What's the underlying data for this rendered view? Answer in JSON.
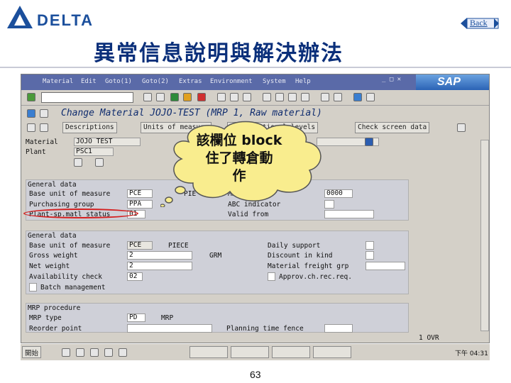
{
  "header": {
    "logo_text": "DELTA",
    "back_label": "Back",
    "title": "異常信息說明與解決辦法"
  },
  "colors": {
    "brand_blue": "#1b4f9c",
    "sap_menu": "#5a6aa8",
    "callout_fill": "#f9ed8e",
    "annotation_red": "#d42020"
  },
  "sap": {
    "menu": [
      "Material",
      "Edit",
      "Goto(1)",
      "Goto(2)",
      "Extras",
      "Environment",
      "System",
      "Help"
    ],
    "brand": "SAP",
    "transaction_title": "Change Material JOJO-TEST (MRP 1, Raw material)",
    "buttons": [
      "Descriptions",
      "Units of measure",
      "Organizational levels",
      "Check screen data"
    ],
    "header_fields": {
      "material_label": "Material",
      "material_value": "JOJO TEST",
      "plant_label": "Plant",
      "plant_value": "PSC1"
    },
    "general_data_1": {
      "title": "General data",
      "rows": [
        {
          "label": "Base unit of measure",
          "value": "PCE",
          "extra": "PIE"
        },
        {
          "label": "Purchasing group",
          "value": "PPA"
        },
        {
          "label": "Plant-sp.matl status",
          "value": "01"
        }
      ],
      "right": [
        {
          "label": "MRP group",
          "value": "0000"
        },
        {
          "label": "ABC indicator",
          "value": ""
        },
        {
          "label": "Valid from",
          "value": ""
        }
      ]
    },
    "general_data_2": {
      "title": "General data",
      "rows": [
        {
          "label": "Base unit of measure",
          "value": "PCE",
          "extra": "PIECE"
        },
        {
          "label": "Gross weight",
          "value": "2",
          "extra": "GRM"
        },
        {
          "label": "Net weight",
          "value": "2"
        },
        {
          "label": "Availability check",
          "value": "02"
        }
      ],
      "right": [
        {
          "label": "Daily support"
        },
        {
          "label": "Discount in kind"
        },
        {
          "label": "Material freight grp"
        },
        {
          "label": "Approv.ch.rec.req."
        }
      ],
      "checkbox": "Batch management"
    },
    "mrp_procedure": {
      "title": "MRP procedure",
      "rows": [
        {
          "label": "MRP type",
          "value": "PD",
          "extra": "MRP"
        },
        {
          "label": "Reorder point",
          "value": ""
        }
      ],
      "right_label": "Planning time fence"
    }
  },
  "taskbar": {
    "start": "開始",
    "clock": "下午 04:31",
    "tray_text": "1  OVR"
  },
  "callout": {
    "line1": "該欄位 block",
    "line2": "住了轉倉動",
    "line3": "作"
  },
  "page_number": "63"
}
